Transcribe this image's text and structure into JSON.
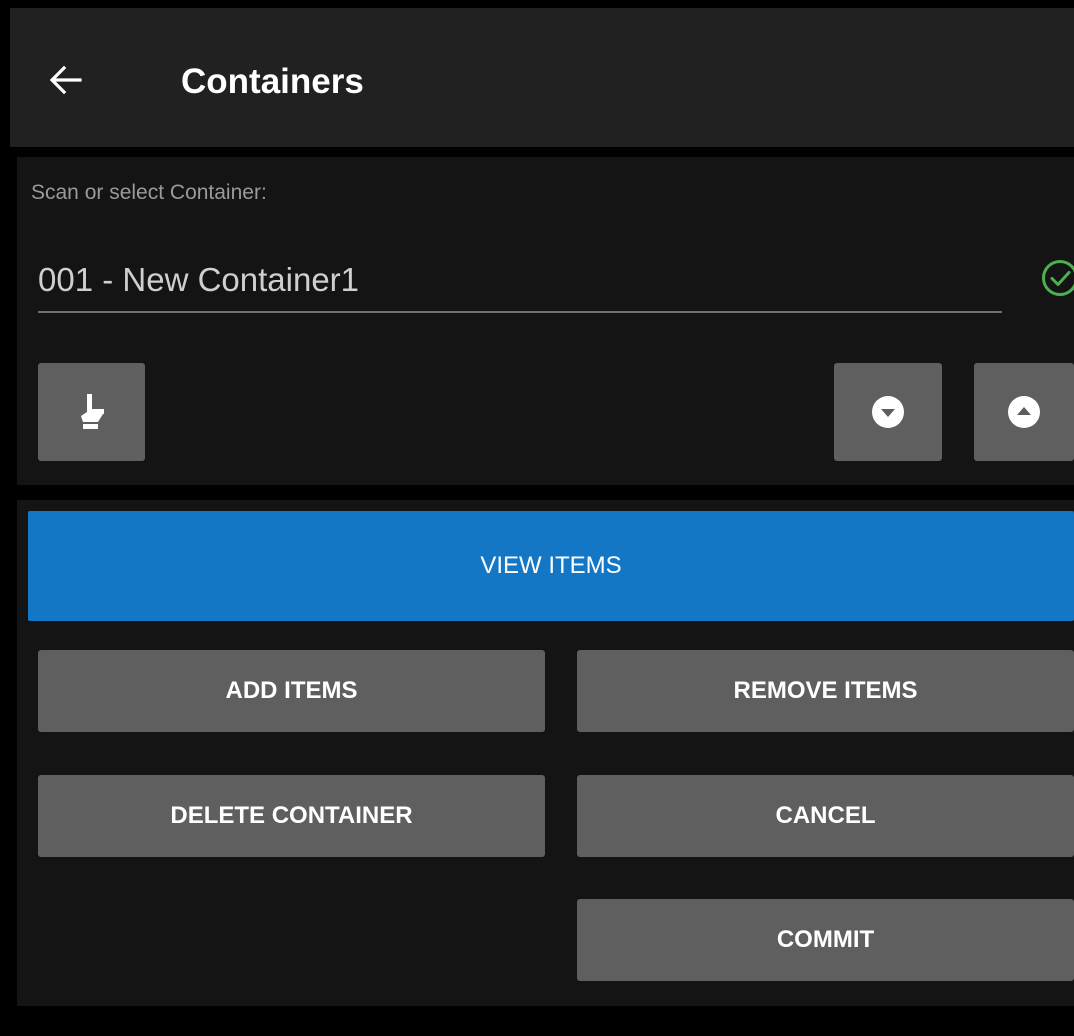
{
  "header": {
    "back_icon": "arrow-left-icon",
    "title": "Containers"
  },
  "container_select": {
    "label": "Scan or select Container:",
    "value": "001 - New Container1",
    "status_icon": "check-circle-icon",
    "status_color": "#4caf50"
  },
  "controls": {
    "hand_icon": "hand-pointer-icon",
    "down_icon": "chevron-down-circle-icon",
    "up_icon": "chevron-up-circle-icon"
  },
  "actions": {
    "view_items": "VIEW ITEMS",
    "add_items": "ADD ITEMS",
    "remove_items": "REMOVE ITEMS",
    "delete_container": "DELETE CONTAINER",
    "cancel": "CANCEL",
    "commit": "COMMIT"
  },
  "colors": {
    "accent": "#1377c6",
    "button": "#5f5f60",
    "toolbar": "#212121",
    "panel": "#141414"
  }
}
